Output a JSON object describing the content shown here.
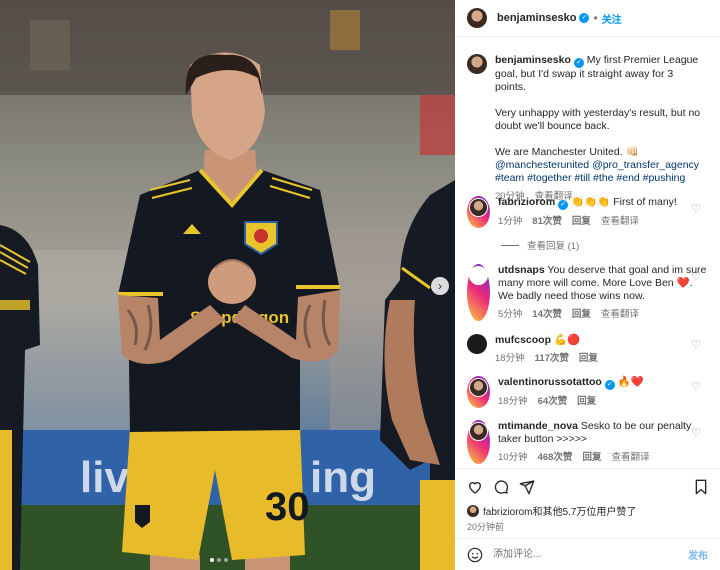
{
  "post": {
    "author": "benjaminsesko",
    "follow_label": "关注",
    "jersey_number": "30",
    "sponsor_text": "Snapdragon",
    "caption": {
      "line1": "My first Premier League goal, but I'd swap it straight away for 3 points.",
      "line2": "Very unhappy with yesterday's result, but no doubt we'll bounce back.",
      "line3": "We are Manchester United. 👊🏻",
      "mention1": "@manchesterunited",
      "mention2": "@pro_transfer_agency",
      "hashtags": "#team #together #till #the #end #pushing",
      "time": "20分钟",
      "translate": "查看翻译"
    }
  },
  "comments": [
    {
      "user": "fabriziorom",
      "verified": true,
      "text": "👏👏👏 First of many!",
      "time": "1分钟",
      "likes": "81次赞",
      "reply": "回复",
      "translate": "查看翻译"
    },
    {
      "user": "utdsnaps",
      "verified": false,
      "text": "You deserve that goal and im sure many more will come. More Love Ben ❤️. We badly need those wins now.",
      "time": "5分钟",
      "likes": "14次赞",
      "reply": "回复",
      "translate": "查看翻译"
    },
    {
      "user": "mufcscoop",
      "verified": false,
      "text": "💪🔴",
      "time": "18分钟",
      "likes": "117次赞",
      "reply": "回复",
      "translate": ""
    },
    {
      "user": "valentinorussotattoo",
      "verified": true,
      "text": "🔥❤️",
      "time": "18分钟",
      "likes": "64次赞",
      "reply": "回复",
      "translate": ""
    },
    {
      "user": "mtimande_nova",
      "verified": false,
      "text": "Sesko to be our penalty taker button >>>>>",
      "time": "10分钟",
      "likes": "468次赞",
      "reply": "回复",
      "translate": "查看翻译"
    }
  ],
  "replies_label": "查看回复 (1)",
  "likes_summary": "fabriziorom和其他5.7万位用户赞了",
  "posted_ago": "20分钟前",
  "composer": {
    "placeholder": "添加评论...",
    "post_label": "发布"
  },
  "colors": {
    "accent": "#0095f6",
    "kit_navy": "#141821",
    "kit_gold": "#e8c52a",
    "shorts_yellow": "#e7bb2a"
  }
}
